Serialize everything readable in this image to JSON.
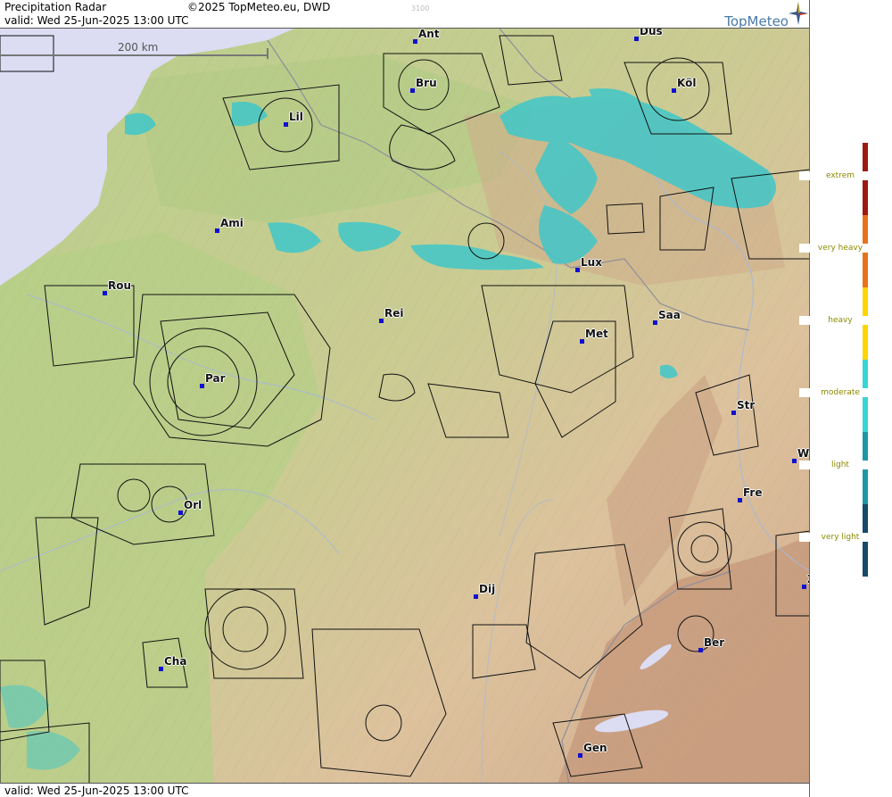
{
  "header": {
    "title": "Precipitation Radar",
    "copyright": "©2025 TopMeteo.eu, DWD",
    "valid": "valid:  Wed  25-Jun-2025 13:00 UTC",
    "elev_marker": "3100"
  },
  "footer": {
    "valid": "valid:  Wed  25-Jun-2025 13:00 UTC"
  },
  "logo": {
    "text": "TopMeteo"
  },
  "scale": {
    "label": "200 km"
  },
  "cities": [
    {
      "key": "ant",
      "label": "Ant"
    },
    {
      "key": "dus",
      "label": "Düs"
    },
    {
      "key": "bru",
      "label": "Bru"
    },
    {
      "key": "kol",
      "label": "Köl"
    },
    {
      "key": "lil",
      "label": "Lil"
    },
    {
      "key": "ami",
      "label": "Ami"
    },
    {
      "key": "lux",
      "label": "Lux"
    },
    {
      "key": "rou",
      "label": "Rou"
    },
    {
      "key": "rei",
      "label": "Rei"
    },
    {
      "key": "saa",
      "label": "Saa"
    },
    {
      "key": "met",
      "label": "Met"
    },
    {
      "key": "par",
      "label": "Par"
    },
    {
      "key": "str",
      "label": "Str"
    },
    {
      "key": "w",
      "label": "W"
    },
    {
      "key": "fre",
      "label": "Fre"
    },
    {
      "key": "orl",
      "label": "Orl"
    },
    {
      "key": "dij",
      "label": "Dij"
    },
    {
      "key": "z",
      "label": "Z"
    },
    {
      "key": "ber",
      "label": "Ber"
    },
    {
      "key": "cha",
      "label": "Cha"
    },
    {
      "key": "gen",
      "label": "Gen"
    }
  ],
  "legend": {
    "levels": [
      {
        "label": "extrem",
        "color": "#9e1a10"
      },
      {
        "label": "very heavy",
        "color": "#e8731c"
      },
      {
        "label": "heavy",
        "color": "#ffd400"
      },
      {
        "label": "moderate",
        "color": "#36d6d6"
      },
      {
        "label": "light",
        "color": "#1e97a8"
      },
      {
        "label": "very light",
        "color": "#154a6a"
      }
    ]
  },
  "colors": {
    "sea": "#dcdcf2",
    "lowland": "#b9cf8e",
    "hills": "#d9c49b",
    "mountains": "#cfa487",
    "radar": "#3fc7c9",
    "city_dot": "#1010d0"
  }
}
